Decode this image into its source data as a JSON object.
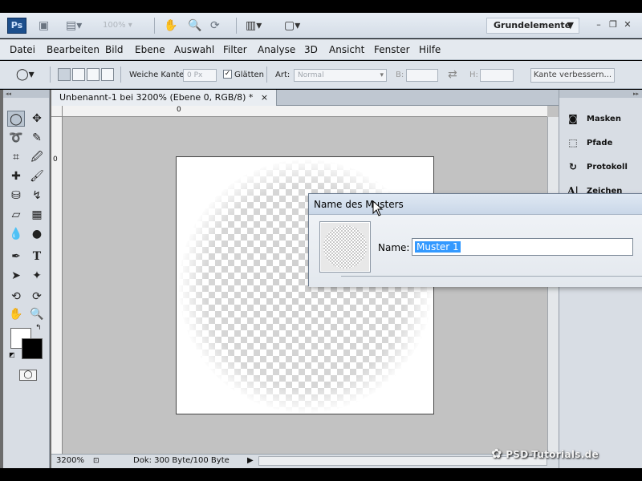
{
  "app": {
    "logo": "Ps"
  },
  "appbar": {
    "zoom": "100%",
    "workspace": "Grundelemente",
    "workspace_arrow": "▼"
  },
  "menu": [
    "Datei",
    "Bearbeiten",
    "Bild",
    "Ebene",
    "Auswahl",
    "Filter",
    "Analyse",
    "3D",
    "Ansicht",
    "Fenster",
    "Hilfe"
  ],
  "options": {
    "feather_label": "Weiche Kante:",
    "feather_value": "0 Px",
    "antialias_label": "Glätten",
    "antialias_checked": "✓",
    "style_label": "Art:",
    "style_value": "Normal",
    "width_label": "B:",
    "height_label": "H:",
    "refine_edge_label": "Kante verbessern..."
  },
  "document": {
    "tab_title": "Unbenannt-1 bei 3200% (Ebene 0, RGB/8) *",
    "tab_close": "×",
    "ruler_h_zero": "0",
    "ruler_v_zero": "0",
    "status_zoom": "3200%",
    "status_doc": "Dok: 300 Byte/100 Byte"
  },
  "panels": [
    {
      "icon": "masks-icon",
      "label": "Masken"
    },
    {
      "icon": "paths-icon",
      "label": "Pfade"
    },
    {
      "icon": "history-icon",
      "label": "Protokoll"
    },
    {
      "icon": "character-icon",
      "label": "Zeichen"
    }
  ],
  "dialog": {
    "title": "Name des Musters",
    "name_label": "Name:",
    "name_value": "Muster 1"
  },
  "watermark": "PSD-Tutorials.de",
  "colors": {
    "foreground": "#ffffff",
    "background": "#000000",
    "selection": "#3399ff"
  }
}
